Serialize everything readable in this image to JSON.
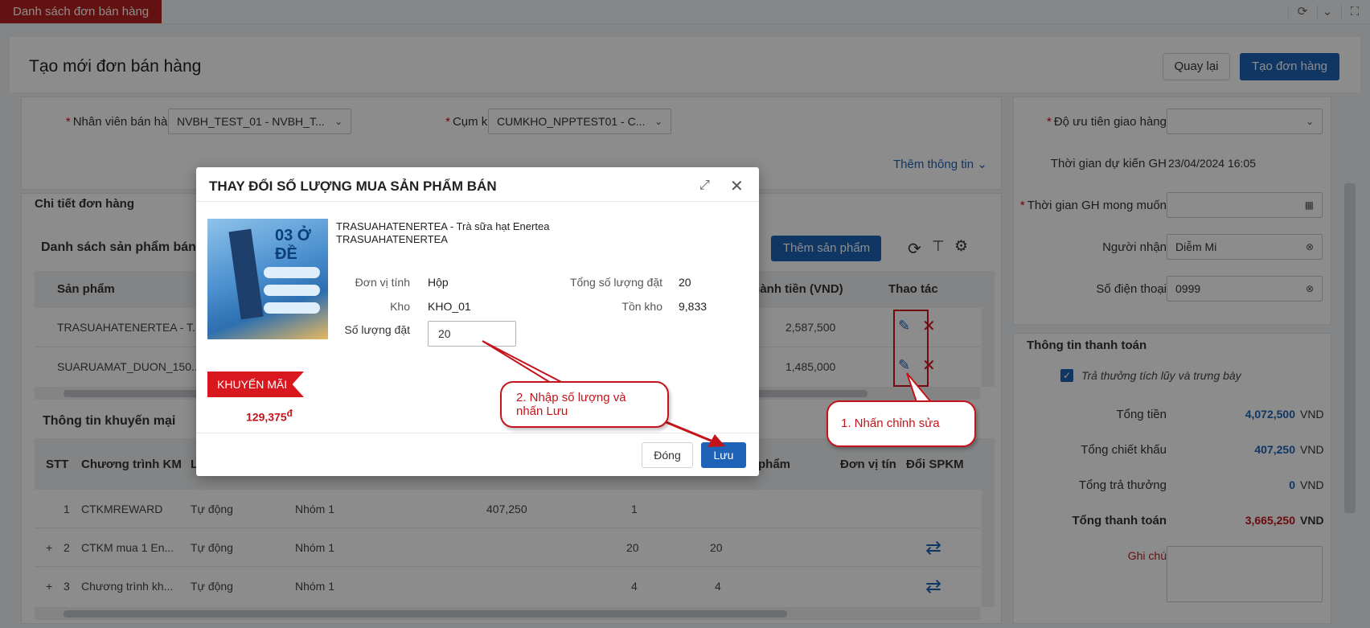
{
  "topbar": {
    "tab_label": "Danh sách đơn bán hàng"
  },
  "header": {
    "title": "Tạo mới đơn bán hàng",
    "back_label": "Quay lại",
    "create_label": "Tạo đơn hàng"
  },
  "form": {
    "salesperson_label": "Nhân viên bán hàng",
    "salesperson_value": "NVBH_TEST_01 - NVBH_T...",
    "warehouse_label": "Cụm kho",
    "warehouse_value": "CUMKHO_NPPTEST01 - C...",
    "more_info_link": "Thêm thông tin"
  },
  "details": {
    "section_title": "Chi tiết đơn hàng",
    "product_list_title": "Danh sách sản phẩm bán",
    "add_product_label": "Thêm sản phẩm",
    "columns": {
      "product": "Sản phẩm",
      "amount": "Thành tiền (VND)",
      "actions": "Thao tác"
    },
    "rows": [
      {
        "product": "TRASUAHATENERTEA - T...",
        "amount": "2,587,500"
      },
      {
        "product": "SUARUAMAT_DUON_150...",
        "amount": "1,485,000"
      }
    ]
  },
  "promo": {
    "section_title": "Thông tin khuyến mại",
    "columns": {
      "stt": "STT",
      "program": "Chương trình KM",
      "l": "L",
      "product": "phẩm",
      "unit": "Đơn vị tín",
      "swap": "Đổi SPKM"
    },
    "rows": [
      {
        "expand": "",
        "stt": "1",
        "program": "CTKMREWARD",
        "type": "Tự động",
        "group": "Nhóm 1",
        "value": "407,250",
        "qty1": "1",
        "qty2": ""
      },
      {
        "expand": "+",
        "stt": "2",
        "program": "CTKM mua 1 En...",
        "type": "Tự động",
        "group": "Nhóm 1",
        "value": "",
        "qty1": "20",
        "qty2": "20"
      },
      {
        "expand": "+",
        "stt": "3",
        "program": "Chương trình kh...",
        "type": "Tự động",
        "group": "Nhóm 1",
        "value": "",
        "qty1": "4",
        "qty2": "4"
      }
    ]
  },
  "right": {
    "priority_label": "Độ ưu tiên giao hàng",
    "expected_time_label": "Thời gian dự kiến GH",
    "expected_time_value": "23/04/2024 16:05",
    "desired_time_label": "Thời gian GH mong muốn",
    "receiver_label": "Người nhận",
    "receiver_value": "Diễm Mi",
    "phone_label": "Số điện thoại",
    "phone_value": "0999"
  },
  "payment": {
    "title": "Thông tin thanh toán",
    "checkbox_label": "Trả thưởng tích lũy và trưng bày",
    "total_label": "Tổng tiền",
    "total_value": "4,072,500",
    "discount_label": "Tổng chiết khấu",
    "discount_value": "407,250",
    "reward_label": "Tổng trả thưởng",
    "reward_value": "0",
    "pay_label": "Tổng thanh toán",
    "pay_value": "3,665,250",
    "unit": "VND",
    "note_label": "Ghi chú"
  },
  "modal": {
    "title": "THAY ĐỔI SỐ LƯỢNG MUA SẢN PHẨM BÁN",
    "product_name": "TRASUAHATENERTEA - Trà sữa hạt Enertea",
    "product_code": "TRASUAHATENERTEA",
    "image_text": "03 Ở ĐỀ",
    "badge": "KHUYẾN MÃI",
    "price": "129,375",
    "currency": "đ",
    "unit_label": "Đơn vị tính",
    "unit_value": "Hộp",
    "total_qty_label": "Tổng số lượng đặt",
    "total_qty_value": "20",
    "warehouse_label": "Kho",
    "warehouse_value": "KHO_01",
    "stock_label": "Tồn kho",
    "stock_value": "9,833",
    "qty_label": "Số lượng đặt",
    "qty_value": "20",
    "close_label": "Đóng",
    "save_label": "Lưu"
  },
  "callouts": {
    "step1": "1. Nhấn chỉnh sửa",
    "step2_line1": "2. Nhập số lượng và",
    "step2_line2": "nhấn Lưu"
  },
  "colors": {
    "brand_red": "#b7221f",
    "primary": "#1e63b7",
    "annotation_red": "#c3141b"
  }
}
